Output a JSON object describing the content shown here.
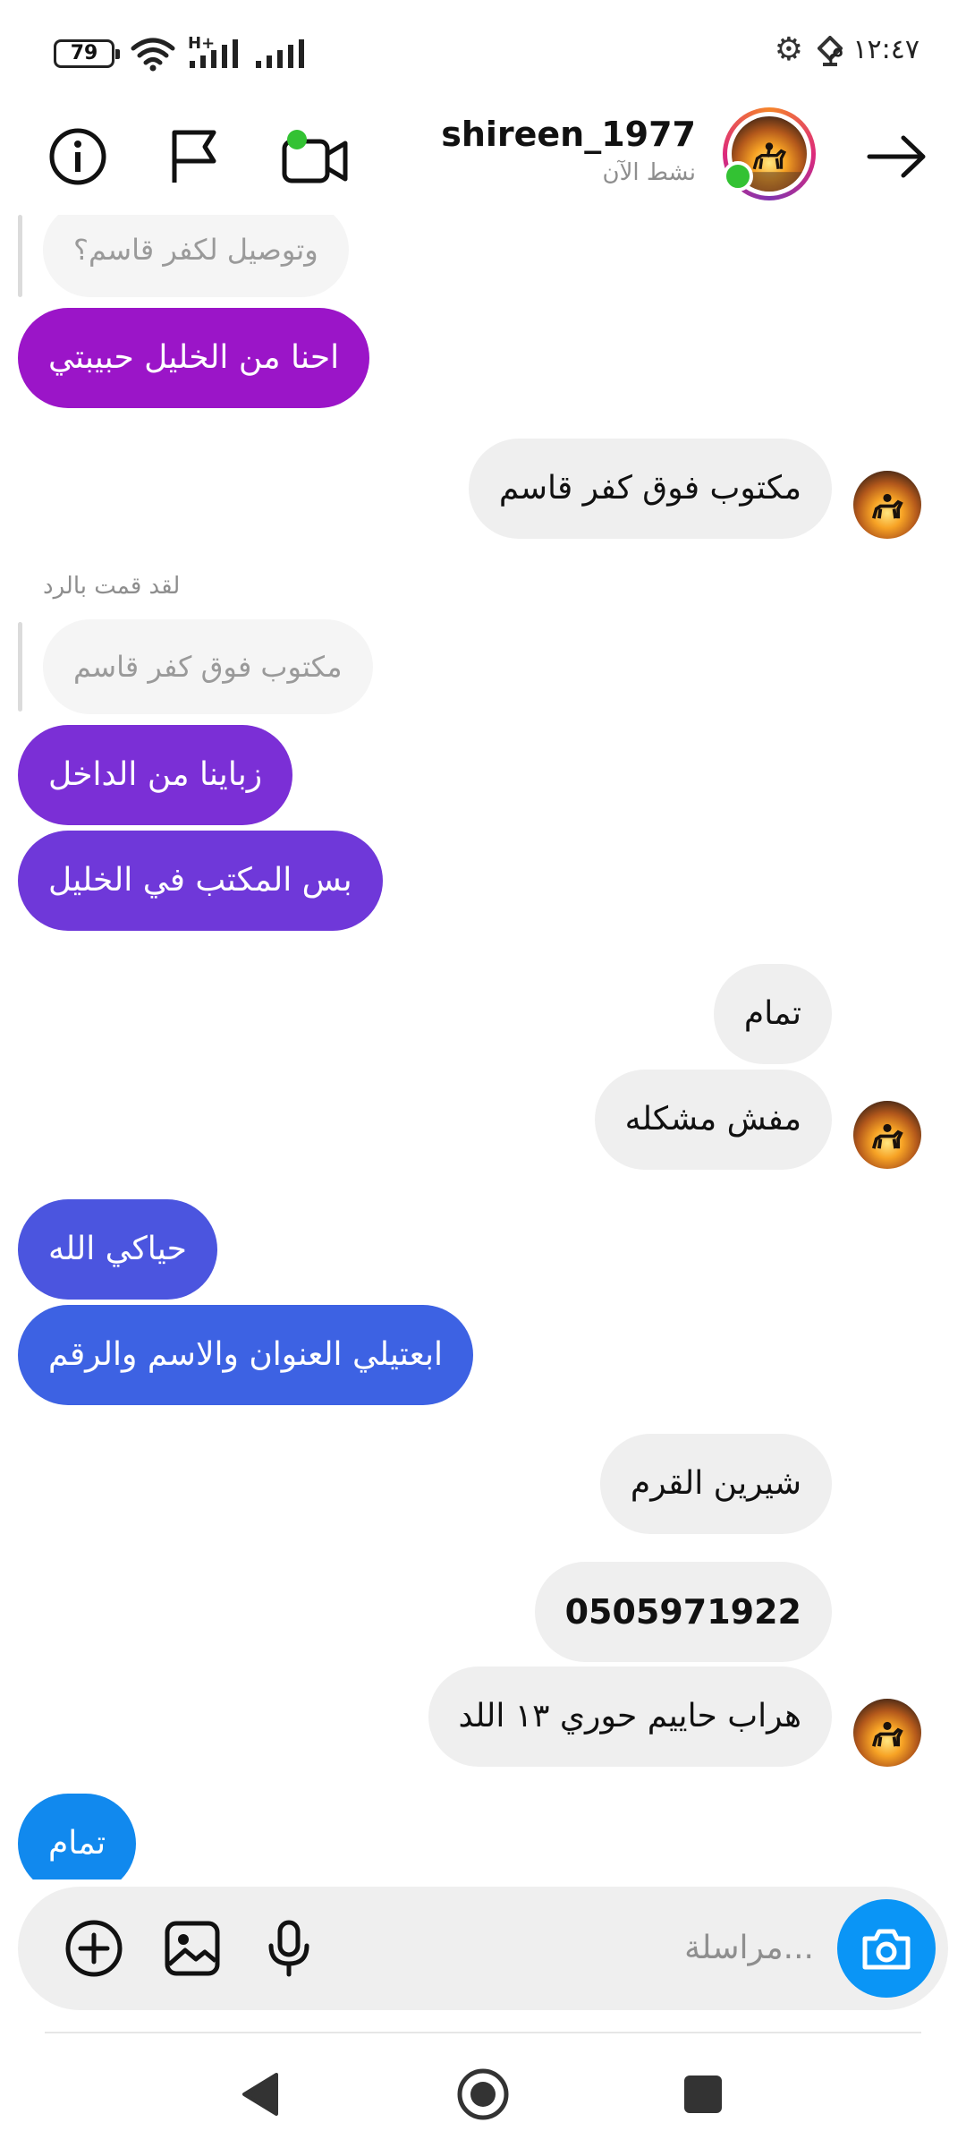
{
  "status_bar": {
    "battery": "79",
    "network": "H+",
    "time": "١٢:٤٧ م"
  },
  "header": {
    "username": "shireen_1977",
    "status": "نشط الآن",
    "icons": [
      "back-arrow-icon",
      "video-call-icon",
      "flag-icon",
      "info-icon"
    ],
    "online_color": "#33c233"
  },
  "messages": {
    "m1_reply_quote": "وتوصيل لكفر قاسم؟",
    "m2": "احنا من الخليل حبيبتي",
    "m3": "مكتوب فوق كفر قاسم",
    "m4_reply_label": "لقد قمت بالرد",
    "m4_reply_quote": "مكتوب فوق كفر قاسم",
    "m5": "زباينا من الداخل",
    "m6": "بس المكتب في الخليل",
    "m7": "تمام",
    "m8": "مفش مشكله",
    "m9": "حياكي الله",
    "m10": "ابعتيلي العنوان والاسم والرقم",
    "m11": "شيرين القرم",
    "m12": "0505971922",
    "m13": "هراب حاييم حوري ١٣ اللد",
    "m14": "تمام"
  },
  "colors": {
    "m2": "#9b15c8",
    "m5": "#7b2fd6",
    "m6": "#6f38d9",
    "m9": "#4b55df",
    "m10": "#3d62e3",
    "m14": "#1189ee",
    "camera_button": "#0a95f6"
  },
  "composer": {
    "placeholder": "مراسلة...",
    "icons": [
      "camera-icon",
      "microphone-icon",
      "gallery-icon",
      "add-icon"
    ]
  },
  "nav": {
    "icons": [
      "nav-back-icon",
      "nav-home-icon",
      "nav-recents-icon"
    ]
  }
}
